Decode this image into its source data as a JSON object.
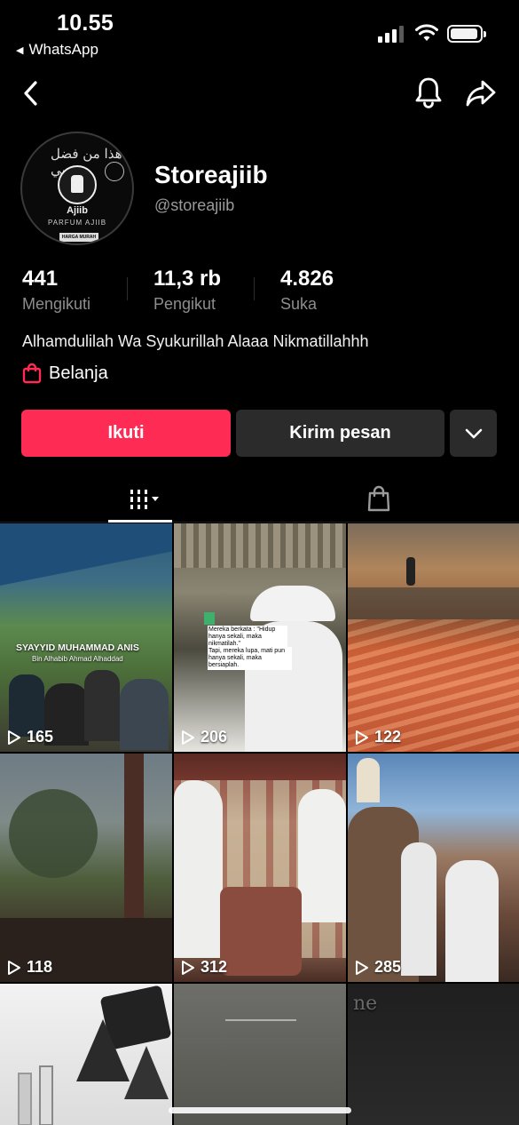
{
  "status": {
    "time": "10.55",
    "back_app": "WhatsApp"
  },
  "profile": {
    "name": "Storeajiib",
    "handle": "@storeajiib",
    "bio": "Alhamdulilah Wa Syukurillah Alaaa Nikmatillahhh",
    "shop_label": "Belanja",
    "avatar": {
      "brand": "Ajiib",
      "subtitle": "PARFUM AJIIB",
      "tag": "HARGA MURAH"
    }
  },
  "stats": [
    {
      "value": "441",
      "label": "Mengikuti"
    },
    {
      "value": "11,3 rb",
      "label": "Pengikut"
    },
    {
      "value": "4.826",
      "label": "Suka"
    }
  ],
  "buttons": {
    "follow": "Ikuti",
    "message": "Kirim pesan"
  },
  "colors": {
    "accent": "#fe2c55",
    "secondary_button": "#2b2b2b"
  },
  "videos": [
    {
      "views": "165",
      "caption": "SYAYYID MUHAMMAD ANIS",
      "caption2": "Bin Alhabib Ahmad Alhaddad"
    },
    {
      "views": "206",
      "caption": "Mereka berkata : \"Hidup hanya sekali, maka nikmatilah.\"",
      "caption2": "Tapi, mereka lupa, mati pun hanya sekali, maka bersiaplah."
    },
    {
      "views": "122",
      "caption": "",
      "caption2": ""
    },
    {
      "views": "118",
      "caption": "",
      "caption2": ""
    },
    {
      "views": "312",
      "caption": "",
      "caption2": ""
    },
    {
      "views": "285",
      "caption": "",
      "caption2": ""
    },
    {
      "views": "",
      "caption": "",
      "caption2": ""
    },
    {
      "views": "",
      "caption": "",
      "caption2": ""
    },
    {
      "views": "",
      "caption": "ne",
      "caption2": ""
    }
  ]
}
